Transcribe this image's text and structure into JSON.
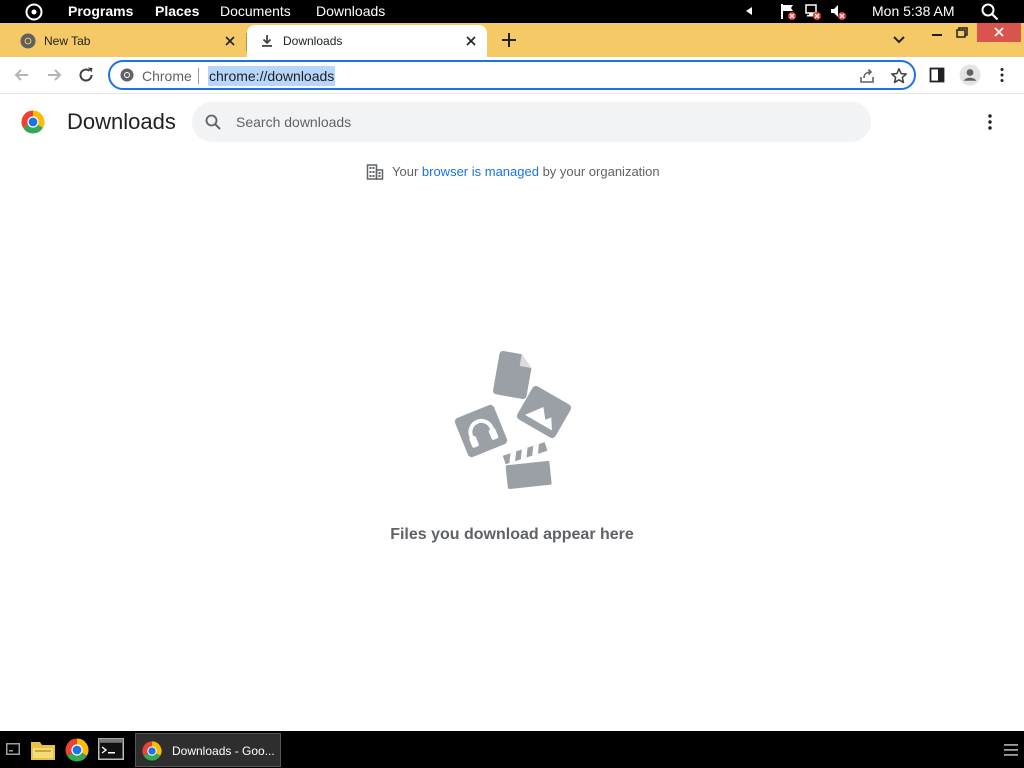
{
  "system_bar": {
    "menus": [
      "Programs",
      "Places",
      "Documents",
      "Downloads"
    ],
    "clock": "Mon 5:38 AM",
    "icons": [
      "activities-icon",
      "volume-arrow-icon",
      "flag-muted-icon",
      "network-error-icon",
      "speaker-muted-icon",
      "search-icon"
    ]
  },
  "browser": {
    "tabs": [
      {
        "title": "New Tab",
        "icon": "chrome-icon",
        "active": false
      },
      {
        "title": "Downloads",
        "icon": "download-icon",
        "active": true
      }
    ],
    "omnibox": {
      "chip_label": "Chrome",
      "url": "chrome://downloads"
    }
  },
  "page": {
    "title": "Downloads",
    "search_placeholder": "Search downloads",
    "managed_notice": {
      "prefix": "Your ",
      "link": "browser is managed",
      "suffix": " by your organization"
    },
    "empty_message": "Files you download appear here"
  },
  "taskbar": {
    "window_label": "Downloads - Goo..."
  },
  "colors": {
    "tab_strip": "#f6c967",
    "accent": "#1a73e8",
    "close_button": "#d9534f",
    "illustration": "#9aa0a6"
  }
}
